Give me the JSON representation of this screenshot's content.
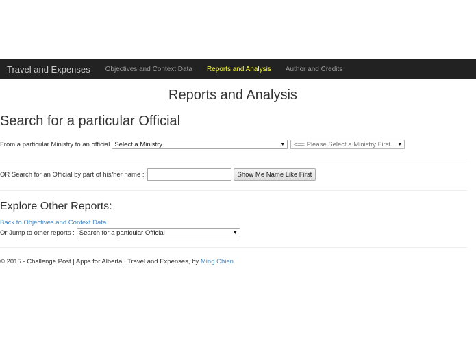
{
  "navbar": {
    "brand": "Travel and Expenses",
    "items": [
      {
        "label": "Objectives and Context Data",
        "active": false
      },
      {
        "label": "Reports and Analysis",
        "active": true
      },
      {
        "label": "Author and Credits",
        "active": false
      }
    ],
    "active_color": "#ffff33"
  },
  "page_title": "Reports and Analysis",
  "search_section": {
    "title": "Search for a particular Official",
    "ministry_label": "From a particular Ministry to an official",
    "ministry_select_value": "Select a Ministry",
    "official_select_value": "<== Please Select a Ministry First",
    "name_label": "OR Search for an Official by part of his/her name :",
    "name_input_value": "",
    "name_button_label": "Show Me Name Like First"
  },
  "explore_section": {
    "title": "Explore Other Reports:",
    "back_link": "Back to Objectives and Context Data",
    "jump_label": "Or Jump to other reports :",
    "jump_select_value": "Search for a particular Official"
  },
  "footer": {
    "text": "© 2015 - Challenge Post | Apps for Alberta | Travel and Expenses, by ",
    "author_link": "Ming Chien"
  },
  "colors": {
    "navbar_bg": "#222222",
    "link": "#428bca"
  }
}
